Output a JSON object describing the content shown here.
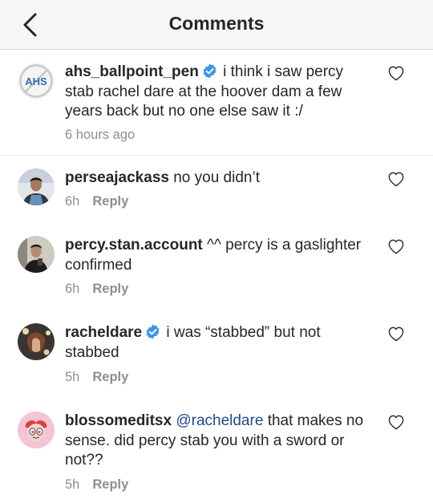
{
  "header": {
    "title": "Comments",
    "back_icon": "chevron-left-icon"
  },
  "accent_colors": {
    "verified": "#3897f0",
    "mention": "#1c4d8c",
    "muted": "#8e8e8e"
  },
  "comments": [
    {
      "username": "ahs_ballpoint_pen",
      "verified": true,
      "text": "i think i saw percy stab rachel dare at the hoover dam a few years back but no one else saw it :/",
      "time": "6 hours ago",
      "avatar_label": "AHS"
    },
    {
      "username": "perseajackass",
      "verified": false,
      "text": "no you didn’t",
      "time": "6h",
      "reply_label": "Reply"
    },
    {
      "username": "percy.stan.account",
      "verified": false,
      "text": "^^ percy is a gaslighter confirmed",
      "time": "6h",
      "reply_label": "Reply"
    },
    {
      "username": "racheldare",
      "verified": true,
      "text": "i was “stabbed” but not stabbed",
      "time": "5h",
      "reply_label": "Reply"
    },
    {
      "username": "blossomeditsx",
      "verified": false,
      "mention": "@racheldare",
      "text": "that makes no sense. did percy stab you with a sword or not??",
      "time": "5h",
      "reply_label": "Reply"
    }
  ]
}
